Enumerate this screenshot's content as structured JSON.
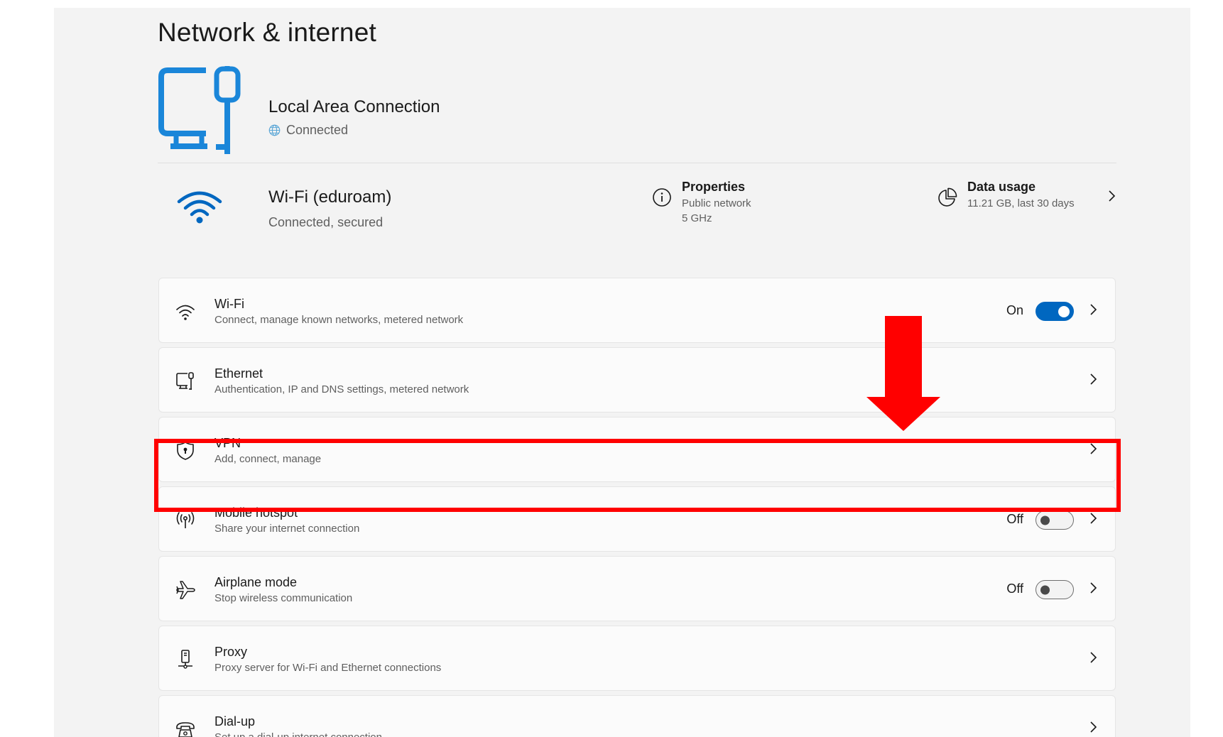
{
  "header": {
    "title": "Network & internet"
  },
  "lan": {
    "title": "Local Area Connection",
    "status": "Connected",
    "icon": "ethernet-monitor-icon"
  },
  "wifi_summary": {
    "title": "Wi-Fi (eduroam)",
    "status": "Connected, secured",
    "properties": {
      "label": "Properties",
      "network_type": "Public network",
      "band": "5 GHz"
    },
    "data_usage": {
      "label": "Data usage",
      "detail": "11.21 GB, last 30 days"
    }
  },
  "settings": {
    "wifi": {
      "label": "Wi-Fi",
      "desc": "Connect, manage known networks, metered network",
      "state": "On"
    },
    "ethernet": {
      "label": "Ethernet",
      "desc": "Authentication, IP and DNS settings, metered network"
    },
    "vpn": {
      "label": "VPN",
      "desc": "Add, connect, manage"
    },
    "hotspot": {
      "label": "Mobile hotspot",
      "desc": "Share your internet connection",
      "state": "Off"
    },
    "airplane": {
      "label": "Airplane mode",
      "desc": "Stop wireless communication",
      "state": "Off"
    },
    "proxy": {
      "label": "Proxy",
      "desc": "Proxy server for Wi-Fi and Ethernet connections"
    },
    "dialup": {
      "label": "Dial-up",
      "desc": "Set up a dial-up internet connection"
    }
  },
  "colors": {
    "accent": "#0067c0",
    "annotation": "#ff0000",
    "lan_icon": "#1a86d9"
  }
}
